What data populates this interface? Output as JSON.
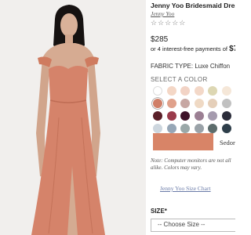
{
  "product": {
    "title": "Jenny Yoo Bridesmaid Dress",
    "brand": "Jenny Yoo",
    "stars": "☆☆☆☆☆",
    "price": "$285",
    "installments_prefix": "or 4 interest-free payments of",
    "installments_amount": "$7",
    "fabric": "FABRIC TYPE: Luxe Chiffon",
    "select_color_label": "SELECT A COLOR",
    "selected_color_name": "Sedor",
    "selected_color_hex": "#d88467",
    "note": "Note: Computer monitors are not all alike. Colors may vary.",
    "size_chart_link": "Jenny Yoo Size Chart",
    "size_label": "SIZE*",
    "size_select_value": "-- Choose Size --"
  },
  "swatches": [
    [
      "#ffffff",
      "#f4d7c6",
      "#f2d3c5",
      "#f3d8c8",
      "#ddd7b3",
      "#f5e7d8"
    ],
    [
      "#d07f68",
      "#e0a18b",
      "#c7a7a3",
      "#efd9c4",
      "#e5cfb9",
      "#c1c1c1"
    ],
    [
      "#5a1f28",
      "#9a3b4b",
      "#3d1228",
      "#9b7f93",
      "#a59bae",
      "#2b2c3a"
    ],
    [
      "#cdd6de",
      "#96a6b6",
      "#9aa8a8",
      "#9aa2a8",
      "#5c6c6c",
      "#2e3e4a"
    ]
  ],
  "selected_swatch": [
    1,
    0
  ]
}
